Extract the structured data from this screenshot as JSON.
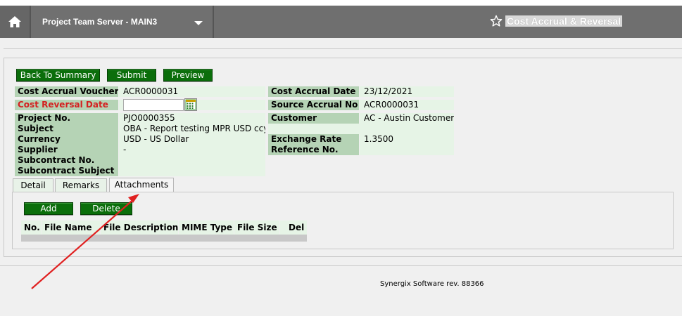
{
  "header": {
    "server_name": "Project Team Server - MAIN3",
    "page_title": "Cost Accrual & Reversal"
  },
  "toolbar": {
    "back_label": "Back To Summary",
    "submit_label": "Submit",
    "preview_label": "Preview"
  },
  "form": {
    "left": [
      {
        "label": "Cost Accrual Voucher",
        "value": "ACR0000031"
      },
      {
        "label": "Cost Reversal Date",
        "value": ""
      },
      {
        "label": "Project No.",
        "value": "PJO0000355"
      },
      {
        "label": "Subject",
        "value": "OBA - Report testing MPR USD ccy"
      },
      {
        "label": "Currency",
        "value": "USD - US Dollar"
      },
      {
        "label": "Supplier",
        "value": "-"
      },
      {
        "label": "Subcontract No.",
        "value": ""
      },
      {
        "label": "Subcontract Subject",
        "value": ""
      }
    ],
    "right": [
      {
        "label": "Cost Accrual Date",
        "value": "23/12/2021"
      },
      {
        "label": "Source Accrual No",
        "value": "ACR0000031"
      },
      {
        "label": "Customer",
        "value": "AC - Austin Customer"
      },
      {
        "label": "Exchange Rate",
        "value": "1.3500"
      },
      {
        "label": "Reference No.",
        "value": ""
      }
    ]
  },
  "tabs": [
    "Detail",
    "Remarks",
    "Attachments"
  ],
  "attachments": {
    "add_label": "Add",
    "delete_label": "Delete",
    "columns": [
      "No.",
      "File Name",
      "File Description",
      "MIME Type",
      "File Size",
      "Del"
    ]
  },
  "footer": {
    "text": "Synergix Software rev. 88366"
  },
  "colors": {
    "header_bg": "#6f6f6f",
    "button_green": "#0b6e0b",
    "label_bg": "#b5d3b5",
    "value_bg": "#e6f4e6",
    "required_red": "#d42020",
    "annotation_arrow": "#e02020"
  }
}
